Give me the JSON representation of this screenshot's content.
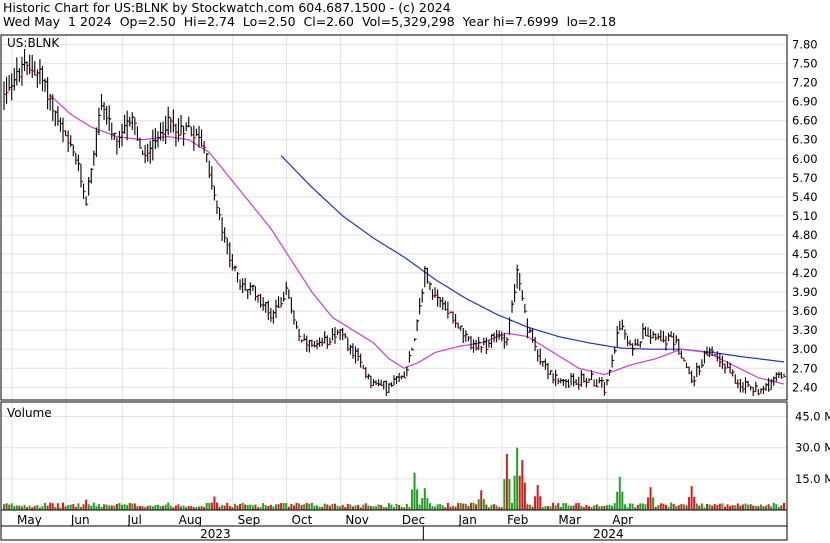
{
  "header": {
    "line1": "Historic Chart for US:BLNK by Stockwatch.com 604.687.1500 - (c) 2024",
    "line2": "Wed May  1 2024  Op=2.50  Hi=2.74  Lo=2.50  Cl=2.60  Vol=5,329,298  Year hi=7.6999  lo=2.18"
  },
  "chart_data": [
    {
      "type": "ohlc",
      "title": "US:BLNK",
      "y_ticks": [
        "7.80",
        "7.50",
        "7.20",
        "6.90",
        "6.60",
        "6.30",
        "6.00",
        "5.70",
        "5.40",
        "5.10",
        "4.80",
        "4.50",
        "4.20",
        "3.90",
        "3.60",
        "3.30",
        "3.00",
        "2.70",
        "2.40"
      ],
      "ylim": [
        2.2,
        7.95
      ],
      "x_months": [
        "May",
        "Jun",
        "Jul",
        "Aug",
        "Sep",
        "Oct",
        "Nov",
        "Dec",
        "Jan",
        "Feb",
        "Mar",
        "Apr"
      ],
      "years": [
        "2023",
        "2024"
      ],
      "grid": true,
      "month_anchors": [
        {
          "d": 0,
          "p": 7.05
        },
        {
          "d": 8,
          "p": 7.45
        },
        {
          "d": 14,
          "p": 7.35
        },
        {
          "d": 20,
          "p": 6.7
        },
        {
          "d": 24,
          "p": 6.3
        },
        {
          "d": 28,
          "p": 6.0
        },
        {
          "d": 32,
          "p": 5.35
        },
        {
          "d": 38,
          "p": 6.9
        },
        {
          "d": 44,
          "p": 6.2
        },
        {
          "d": 50,
          "p": 6.7
        },
        {
          "d": 54,
          "p": 6.0
        },
        {
          "d": 60,
          "p": 6.3
        },
        {
          "d": 64,
          "p": 6.6
        },
        {
          "d": 68,
          "p": 6.45
        },
        {
          "d": 72,
          "p": 6.5
        },
        {
          "d": 78,
          "p": 6.2
        },
        {
          "d": 82,
          "p": 5.4
        },
        {
          "d": 86,
          "p": 4.7
        },
        {
          "d": 92,
          "p": 4.0
        },
        {
          "d": 98,
          "p": 3.9
        },
        {
          "d": 104,
          "p": 3.55
        },
        {
          "d": 110,
          "p": 3.9
        },
        {
          "d": 116,
          "p": 3.1
        },
        {
          "d": 122,
          "p": 3.0
        },
        {
          "d": 130,
          "p": 3.3
        },
        {
          "d": 136,
          "p": 2.95
        },
        {
          "d": 144,
          "p": 2.45
        },
        {
          "d": 150,
          "p": 2.4
        },
        {
          "d": 156,
          "p": 2.6
        },
        {
          "d": 160,
          "p": 3.2
        },
        {
          "d": 164,
          "p": 4.2
        },
        {
          "d": 168,
          "p": 3.8
        },
        {
          "d": 174,
          "p": 3.6
        },
        {
          "d": 180,
          "p": 3.15
        },
        {
          "d": 186,
          "p": 3.0
        },
        {
          "d": 192,
          "p": 3.2
        },
        {
          "d": 196,
          "p": 3.2
        },
        {
          "d": 200,
          "p": 4.2
        },
        {
          "d": 204,
          "p": 3.3
        },
        {
          "d": 210,
          "p": 2.8
        },
        {
          "d": 216,
          "p": 2.45
        },
        {
          "d": 222,
          "p": 2.5
        },
        {
          "d": 228,
          "p": 2.55
        },
        {
          "d": 234,
          "p": 2.4
        },
        {
          "d": 240,
          "p": 3.4
        },
        {
          "d": 244,
          "p": 3.0
        },
        {
          "d": 250,
          "p": 3.3
        },
        {
          "d": 256,
          "p": 3.2
        },
        {
          "d": 262,
          "p": 3.1
        },
        {
          "d": 268,
          "p": 2.5
        },
        {
          "d": 274,
          "p": 2.95
        },
        {
          "d": 280,
          "p": 2.8
        },
        {
          "d": 286,
          "p": 2.5
        },
        {
          "d": 292,
          "p": 2.35
        },
        {
          "d": 298,
          "p": 2.45
        },
        {
          "d": 304,
          "p": 2.6
        }
      ],
      "ma_short_anchors": [
        {
          "d": 18,
          "p": 7.0
        },
        {
          "d": 26,
          "p": 6.7
        },
        {
          "d": 34,
          "p": 6.5
        },
        {
          "d": 44,
          "p": 6.35
        },
        {
          "d": 54,
          "p": 6.3
        },
        {
          "d": 64,
          "p": 6.35
        },
        {
          "d": 72,
          "p": 6.3
        },
        {
          "d": 80,
          "p": 6.1
        },
        {
          "d": 88,
          "p": 5.7
        },
        {
          "d": 96,
          "p": 5.3
        },
        {
          "d": 104,
          "p": 4.9
        },
        {
          "d": 112,
          "p": 4.4
        },
        {
          "d": 120,
          "p": 3.9
        },
        {
          "d": 128,
          "p": 3.5
        },
        {
          "d": 136,
          "p": 3.3
        },
        {
          "d": 144,
          "p": 3.1
        },
        {
          "d": 150,
          "p": 2.85
        },
        {
          "d": 156,
          "p": 2.7
        },
        {
          "d": 162,
          "p": 2.8
        },
        {
          "d": 168,
          "p": 2.95
        },
        {
          "d": 178,
          "p": 3.05
        },
        {
          "d": 186,
          "p": 3.1
        },
        {
          "d": 196,
          "p": 3.25
        },
        {
          "d": 204,
          "p": 3.2
        },
        {
          "d": 214,
          "p": 2.95
        },
        {
          "d": 224,
          "p": 2.7
        },
        {
          "d": 234,
          "p": 2.6
        },
        {
          "d": 244,
          "p": 2.75
        },
        {
          "d": 254,
          "p": 2.85
        },
        {
          "d": 264,
          "p": 3.0
        },
        {
          "d": 274,
          "p": 2.95
        },
        {
          "d": 284,
          "p": 2.75
        },
        {
          "d": 294,
          "p": 2.55
        },
        {
          "d": 304,
          "p": 2.45
        }
      ],
      "ma_long_anchors": [
        {
          "d": 108,
          "p": 6.05
        },
        {
          "d": 120,
          "p": 5.55
        },
        {
          "d": 132,
          "p": 5.1
        },
        {
          "d": 144,
          "p": 4.75
        },
        {
          "d": 156,
          "p": 4.45
        },
        {
          "d": 168,
          "p": 4.1
        },
        {
          "d": 180,
          "p": 3.8
        },
        {
          "d": 192,
          "p": 3.55
        },
        {
          "d": 204,
          "p": 3.35
        },
        {
          "d": 216,
          "p": 3.2
        },
        {
          "d": 228,
          "p": 3.1
        },
        {
          "d": 240,
          "p": 3.02
        },
        {
          "d": 252,
          "p": 3.0
        },
        {
          "d": 264,
          "p": 3.0
        },
        {
          "d": 276,
          "p": 2.95
        },
        {
          "d": 288,
          "p": 2.88
        },
        {
          "d": 304,
          "p": 2.8
        }
      ]
    },
    {
      "type": "bar",
      "title": "Volume",
      "y_ticks": [
        "45.0",
        "30.0",
        "15.0"
      ],
      "y_unit": "M",
      "ylim": [
        0,
        52
      ],
      "spikes": [
        {
          "d": 32,
          "v": 5.0
        },
        {
          "d": 82,
          "v": 6.5
        },
        {
          "d": 160,
          "v": 18.0
        },
        {
          "d": 164,
          "v": 10.5
        },
        {
          "d": 186,
          "v": 9.5
        },
        {
          "d": 196,
          "v": 27.0
        },
        {
          "d": 200,
          "v": 30.0
        },
        {
          "d": 202,
          "v": 24.0
        },
        {
          "d": 208,
          "v": 12.0
        },
        {
          "d": 240,
          "v": 16.0
        },
        {
          "d": 252,
          "v": 11.0
        },
        {
          "d": 268,
          "v": 11.5
        }
      ]
    }
  ]
}
